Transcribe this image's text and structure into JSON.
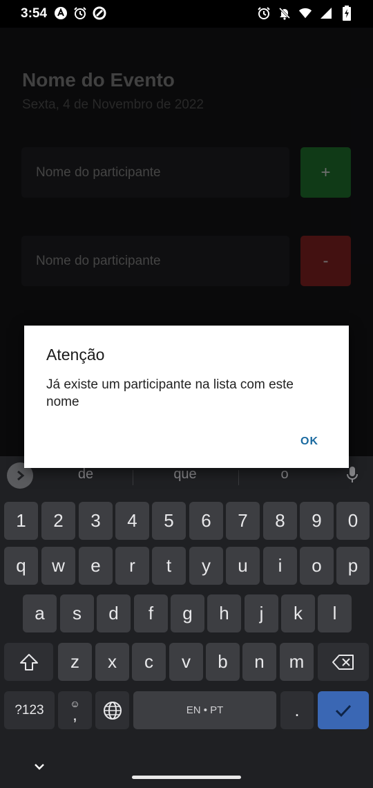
{
  "status_bar": {
    "time": "3:54",
    "icons_left": [
      "a-icon",
      "alarm-icon",
      "sync-icon"
    ],
    "icons_right": [
      "alarm-icon",
      "notifications-off-icon",
      "wifi-icon",
      "signal-icon",
      "battery-icon"
    ]
  },
  "app": {
    "event_title": "Nome do Evento",
    "event_date": "Sexta, 4 de Novembro de 2022",
    "participant_placeholder_1": "Nome do participante",
    "participant_placeholder_2": "Nome do participante",
    "add_button_label": "+",
    "remove_button_label": "-",
    "colors": {
      "add_button": "#1e6b2b",
      "remove_button": "#7a1f1f"
    }
  },
  "dialog": {
    "title": "Atenção",
    "message": "Já existe um participante na lista com este nome",
    "ok_label": "OK"
  },
  "keyboard": {
    "suggestions": [
      "de",
      "que",
      "o"
    ],
    "row_numbers": [
      "1",
      "2",
      "3",
      "4",
      "5",
      "6",
      "7",
      "8",
      "9",
      "0"
    ],
    "row_top": [
      "q",
      "w",
      "e",
      "r",
      "t",
      "y",
      "u",
      "i",
      "o",
      "p"
    ],
    "row_middle": [
      "a",
      "s",
      "d",
      "f",
      "g",
      "h",
      "j",
      "k",
      "l"
    ],
    "row_bottom": [
      "z",
      "x",
      "c",
      "v",
      "b",
      "n",
      "m"
    ],
    "symbols_label": "?123",
    "emoji_comma_label": ",",
    "space_label": "EN • PT",
    "period_label": ".",
    "enter_color": "#3a67b4"
  }
}
